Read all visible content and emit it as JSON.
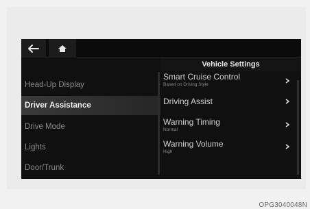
{
  "screen": {
    "title": "Vehicle Settings",
    "left_menu": [
      {
        "label": "Head-Up Display"
      },
      {
        "label": "Driver Assistance",
        "active": true
      },
      {
        "label": "Drive Mode"
      },
      {
        "label": "Lights"
      },
      {
        "label": "Door/Trunk"
      }
    ],
    "right_menu": [
      {
        "label": "Smart Cruise Control",
        "sub": "Based on Driving Style"
      },
      {
        "label": "Driving Assist",
        "sub": ""
      },
      {
        "label": "Warning Timing",
        "sub": "Normal"
      },
      {
        "label": "Warning Volume",
        "sub": "High"
      }
    ],
    "icons": {
      "back": "back-arrow-icon",
      "home": "home-icon",
      "chevron": "chevron-right-icon"
    }
  },
  "caption": "OPG3040048N",
  "colors": {
    "screen_bg": "#101010",
    "active_item": "#3a3a3a",
    "text": "#cfcfcf"
  }
}
